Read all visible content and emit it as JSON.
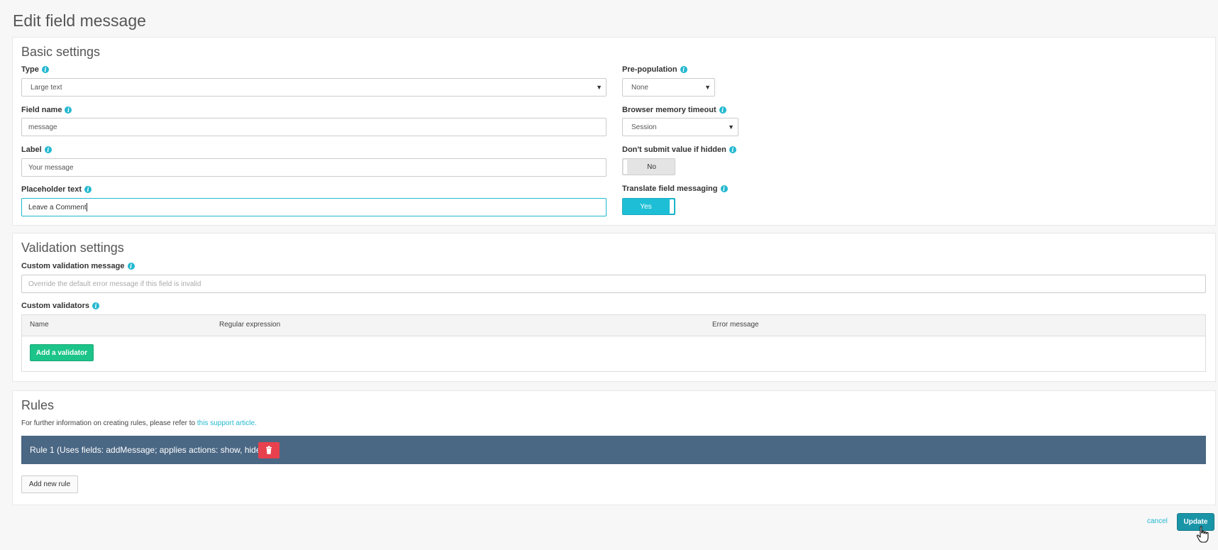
{
  "page": {
    "title": "Edit field message"
  },
  "basic": {
    "title": "Basic settings",
    "type": {
      "label": "Type",
      "value": "Large text"
    },
    "field_name": {
      "label": "Field name",
      "value": "message"
    },
    "label": {
      "label": "Label",
      "value": "Your message"
    },
    "placeholder": {
      "label": "Placeholder text",
      "value": "Leave a Comment"
    },
    "pre_population": {
      "label": "Pre-population",
      "value": "None"
    },
    "memory_timeout": {
      "label": "Browser memory timeout",
      "value": "Session"
    },
    "dont_submit": {
      "label": "Don't submit value if hidden",
      "value": "No"
    },
    "translate": {
      "label": "Translate field messaging",
      "value": "Yes"
    }
  },
  "validation": {
    "title": "Validation settings",
    "custom_message": {
      "label": "Custom validation message",
      "placeholder": "Override the default error message if this field is invalid"
    },
    "validators": {
      "label": "Custom validators",
      "columns": [
        "Name",
        "Regular expression",
        "Error message"
      ],
      "add_button": "Add a validator"
    }
  },
  "rules": {
    "title": "Rules",
    "info_prefix": "For further information on creating rules, please refer to ",
    "info_link": "this support article",
    "info_suffix": ".",
    "items": [
      {
        "text": "Rule 1 (Uses fields: addMessage; applies actions: show, hide)"
      }
    ],
    "add_button": "Add new rule"
  },
  "footer": {
    "cancel": "cancel",
    "update": "Update"
  },
  "colors": {
    "accent": "#22b8d0",
    "rule_bar": "#4a6784",
    "delete": "#e8414e",
    "add_green": "#1cc48a",
    "update": "#1a95a8"
  }
}
